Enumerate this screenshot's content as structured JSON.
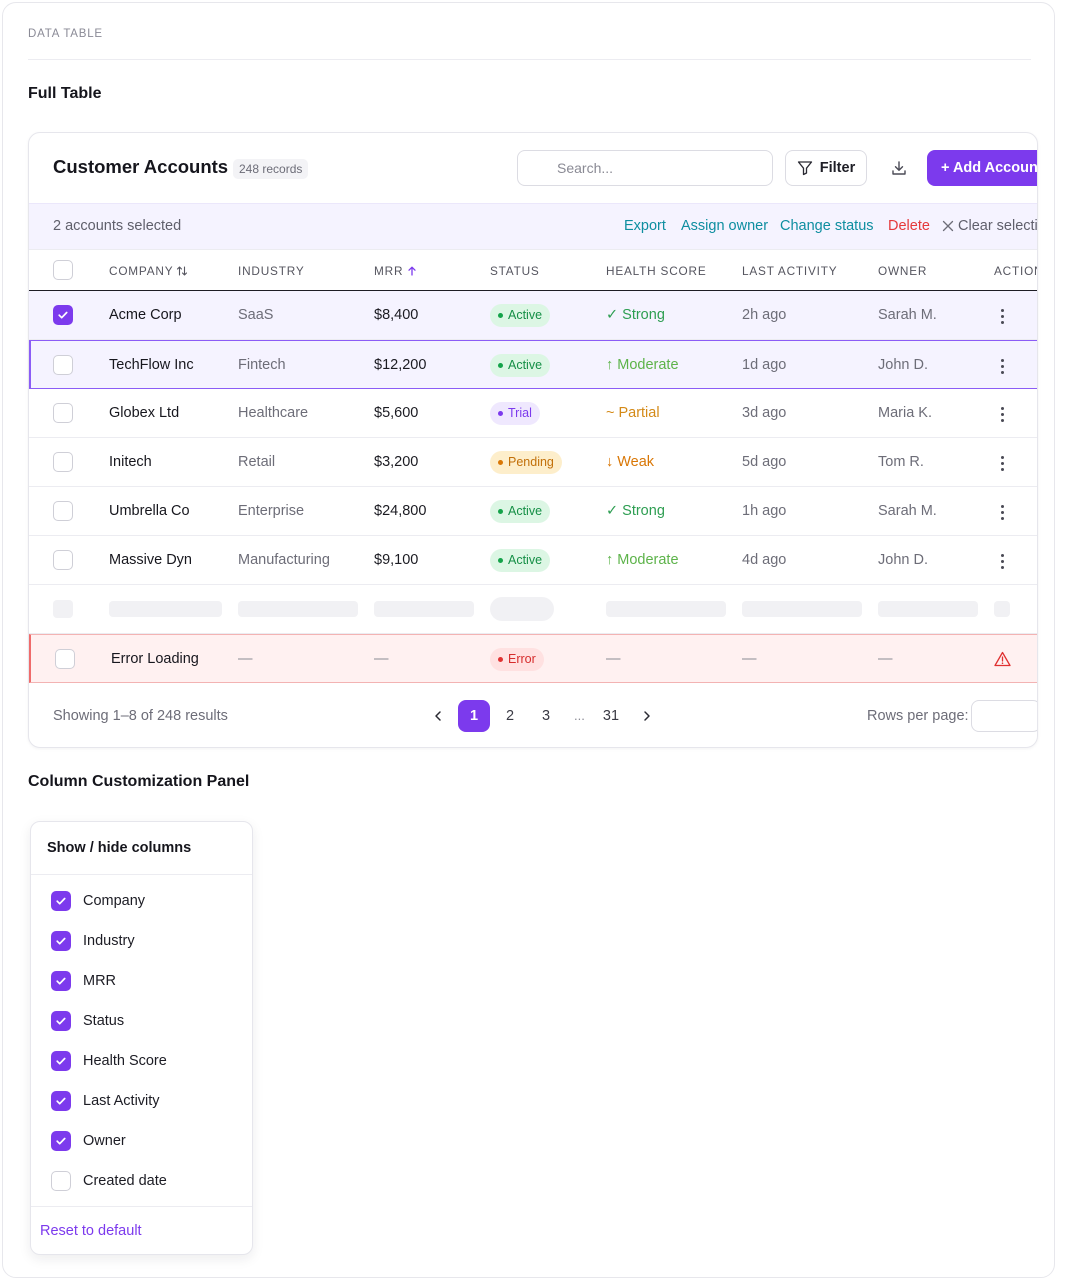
{
  "section": {
    "eyebrow": "DATA TABLE",
    "full_table_title": "Full Table",
    "columns_panel_title": "Column Customization Panel"
  },
  "card": {
    "title": "Customer Accounts",
    "records_badge": "248 records",
    "search_placeholder": "Search...",
    "filter_label": "Filter",
    "add_label": "+ Add Account"
  },
  "bulk": {
    "selected_text": "2 accounts selected",
    "export": "Export",
    "assign_owner": "Assign owner",
    "change_status": "Change status",
    "delete": "Delete",
    "clear": "Clear selection"
  },
  "columns": [
    "COMPANY",
    "INDUSTRY",
    "MRR",
    "STATUS",
    "HEALTH SCORE",
    "LAST ACTIVITY",
    "OWNER",
    "ACTIONS"
  ],
  "rows": [
    {
      "company": "Acme Corp",
      "industry": "SaaS",
      "mrr": "$8,400",
      "status": "Active",
      "status_kind": "active",
      "health": "Strong",
      "health_kind": "strong",
      "health_glyph": "✓",
      "activity": "2h ago",
      "owner": "Sarah M.",
      "checked": true
    },
    {
      "company": "TechFlow Inc",
      "industry": "Fintech",
      "mrr": "$12,200",
      "status": "Active",
      "status_kind": "active",
      "health": "Moderate",
      "health_kind": "moderate",
      "health_glyph": "↑",
      "activity": "1d ago",
      "owner": "John D.",
      "checked": false
    },
    {
      "company": "Globex Ltd",
      "industry": "Healthcare",
      "mrr": "$5,600",
      "status": "Trial",
      "status_kind": "trial",
      "health": "Partial",
      "health_kind": "partial",
      "health_glyph": "~",
      "activity": "3d ago",
      "owner": "Maria K.",
      "checked": false
    },
    {
      "company": "Initech",
      "industry": "Retail",
      "mrr": "$3,200",
      "status": "Pending",
      "status_kind": "pending",
      "health": "Weak",
      "health_kind": "weak",
      "health_glyph": "↓",
      "activity": "5d ago",
      "owner": "Tom R.",
      "checked": false
    },
    {
      "company": "Umbrella Co",
      "industry": "Enterprise",
      "mrr": "$24,800",
      "status": "Active",
      "status_kind": "active",
      "health": "Strong",
      "health_kind": "strong",
      "health_glyph": "✓",
      "activity": "1h ago",
      "owner": "Sarah M.",
      "checked": false
    },
    {
      "company": "Massive Dyn",
      "industry": "Manufacturing",
      "mrr": "$9,100",
      "status": "Active",
      "status_kind": "active",
      "health": "Moderate",
      "health_kind": "moderate",
      "health_glyph": "↑",
      "activity": "4d ago",
      "owner": "John D.",
      "checked": false
    }
  ],
  "error_row": {
    "company": "Error Loading",
    "dash": "—",
    "status": "Error"
  },
  "footer": {
    "showing": "Showing 1–8 of 248 results",
    "pages": [
      "1",
      "2",
      "3",
      "...",
      "31"
    ],
    "active_page": "1",
    "rows_per_page_label": "Rows per page:"
  },
  "column_panel": {
    "title": "Show / hide columns",
    "items": [
      {
        "label": "Company",
        "checked": true
      },
      {
        "label": "Industry",
        "checked": true
      },
      {
        "label": "MRR",
        "checked": true
      },
      {
        "label": "Status",
        "checked": true
      },
      {
        "label": "Health Score",
        "checked": true
      },
      {
        "label": "Last Activity",
        "checked": true
      },
      {
        "label": "Owner",
        "checked": true
      },
      {
        "label": "Created date",
        "checked": false
      }
    ],
    "reset_label": "Reset to default"
  },
  "colors": {
    "accent": "#7c3aed",
    "link": "#0e8ea0",
    "danger": "#e5383b"
  }
}
